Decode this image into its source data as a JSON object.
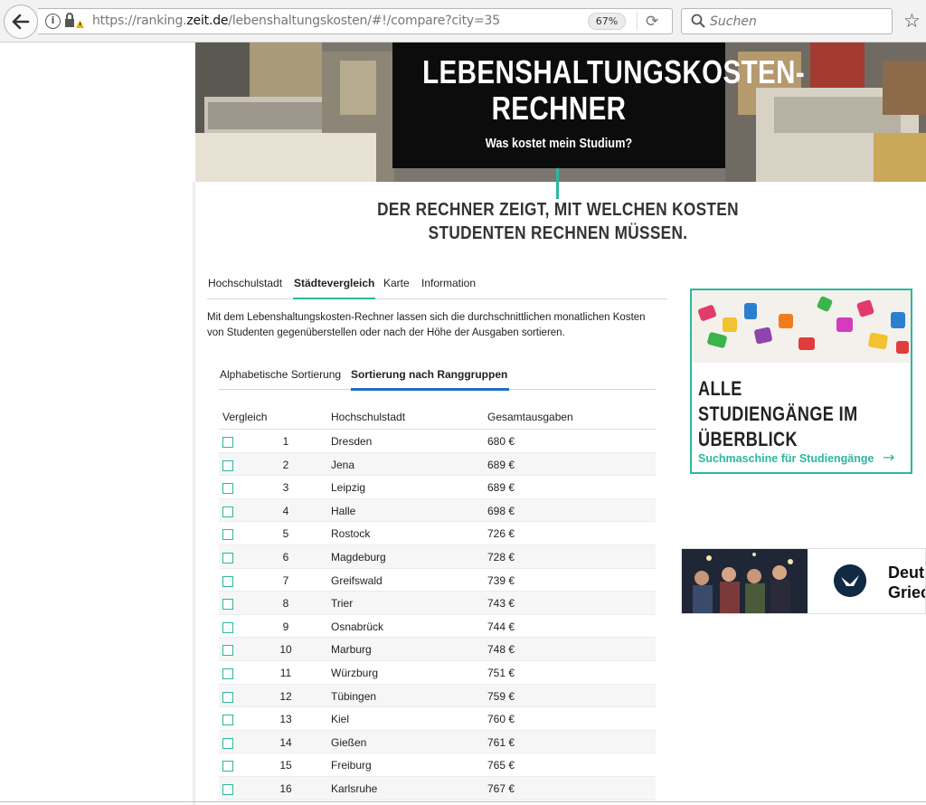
{
  "browser": {
    "url_prefix": "https://ranking.",
    "url_domain": "zeit.de",
    "url_path": "/lebenshaltungskosten/#!/compare?city=35",
    "zoom": "67%",
    "search_placeholder": "Suchen"
  },
  "hero": {
    "title_line1": "LEBENSHALTUNGSKOSTEN-",
    "title_line2": "RECHNER",
    "subtitle": "Was kostet mein Studium?",
    "tagline_line1": "DER RECHNER ZEIGT, MIT WELCHEN KOSTEN",
    "tagline_line2": "STUDENTEN RECHNEN MÜSSEN."
  },
  "tabs": [
    "Hochschulstadt",
    "Städtevergleich",
    "Karte",
    "Information"
  ],
  "active_tab": "Städtevergleich",
  "intro": {
    "line1": "Mit dem Lebenshaltungskosten-Rechner lassen sich die durchschnittlichen monatlichen Kosten",
    "line2": "von Studenten gegenüberstellen oder nach der Höhe der Ausgaben sortieren."
  },
  "subtabs": [
    "Alphabetische Sortierung",
    "Sortierung nach Ranggruppen"
  ],
  "active_subtab": "Sortierung nach Ranggruppen",
  "table": {
    "headers": {
      "compare": "Vergleich",
      "city": "Hochschulstadt",
      "total": "Gesamtausgaben"
    },
    "rows": [
      {
        "rank": "1",
        "city": "Dresden",
        "cost": "680 €"
      },
      {
        "rank": "2",
        "city": "Jena",
        "cost": "689 €"
      },
      {
        "rank": "3",
        "city": "Leipzig",
        "cost": "689 €"
      },
      {
        "rank": "4",
        "city": "Halle",
        "cost": "698 €"
      },
      {
        "rank": "5",
        "city": "Rostock",
        "cost": "726 €"
      },
      {
        "rank": "6",
        "city": "Magdeburg",
        "cost": "728 €"
      },
      {
        "rank": "7",
        "city": "Greifswald",
        "cost": "739 €"
      },
      {
        "rank": "8",
        "city": "Trier",
        "cost": "743 €"
      },
      {
        "rank": "9",
        "city": "Osnabrück",
        "cost": "744 €"
      },
      {
        "rank": "10",
        "city": "Marburg",
        "cost": "748 €"
      },
      {
        "rank": "11",
        "city": "Würzburg",
        "cost": "751 €"
      },
      {
        "rank": "12",
        "city": "Tübingen",
        "cost": "759 €"
      },
      {
        "rank": "13",
        "city": "Kiel",
        "cost": "760 €"
      },
      {
        "rank": "14",
        "city": "Gießen",
        "cost": "761 €"
      },
      {
        "rank": "15",
        "city": "Freiburg",
        "cost": "765 €"
      },
      {
        "rank": "16",
        "city": "Karlsruhe",
        "cost": "767 €"
      }
    ]
  },
  "card": {
    "title_line1": "ALLE STUDIENGÄNGE IM",
    "title_line2": "ÜBERBLICK",
    "link": "Suchmaschine für Studiengänge",
    "arrow": "→"
  },
  "ad2": {
    "line1": "Deuts",
    "line2": "Griec"
  },
  "colors": {
    "accent": "#2bb8a0",
    "subtab_active": "#1e6fc2"
  },
  "icons": {
    "back": "back-arrow-icon",
    "info": "info-icon",
    "lock": "lock-warning-icon",
    "reload": "reload-icon",
    "search": "search-icon",
    "star": "star-icon"
  }
}
